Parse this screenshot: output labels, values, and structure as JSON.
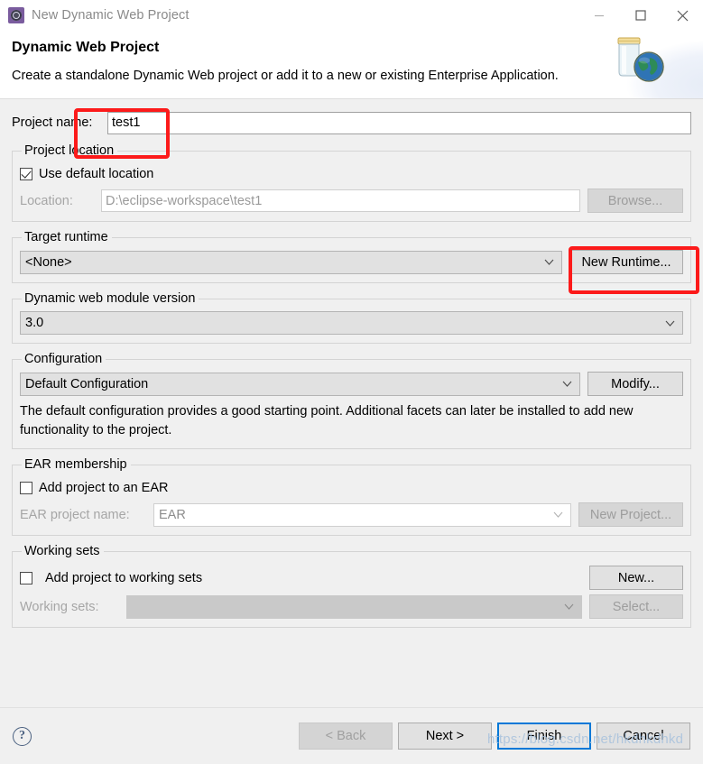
{
  "window": {
    "title": "New Dynamic Web Project",
    "title_icon": "eclipse-project-icon",
    "minimize_icon": "minimize-icon",
    "maximize_icon": "maximize-icon",
    "close_icon": "close-icon"
  },
  "banner": {
    "title": "Dynamic Web Project",
    "description": "Create a standalone Dynamic Web project or add it to a new or existing Enterprise Application.",
    "art_icon": "war-jar-globe-icon"
  },
  "form": {
    "project_name": {
      "label": "Project name:",
      "value": "test1"
    },
    "project_location": {
      "legend": "Project location",
      "use_default_label": "Use default location",
      "use_default_checked": true,
      "location_label": "Location:",
      "location_value": "D:\\eclipse-workspace\\test1",
      "browse_label": "Browse...",
      "browse_enabled": false
    },
    "target_runtime": {
      "legend": "Target runtime",
      "value": "<None>",
      "new_runtime_label": "New Runtime...",
      "new_runtime_enabled": true
    },
    "module_version": {
      "legend": "Dynamic web module version",
      "value": "3.0"
    },
    "configuration": {
      "legend": "Configuration",
      "value": "Default Configuration",
      "modify_label": "Modify...",
      "description": "The default configuration provides a good starting point. Additional facets can later be installed to add new functionality to the project."
    },
    "ear_membership": {
      "legend": "EAR membership",
      "add_to_ear_label": "Add project to an EAR",
      "add_to_ear_checked": false,
      "ear_project_label": "EAR project name:",
      "ear_project_value": "EAR",
      "new_project_label": "New Project...",
      "new_project_enabled": false
    },
    "working_sets": {
      "legend": "Working sets",
      "add_to_working_sets_label": "Add project to working sets",
      "add_to_working_sets_checked": false,
      "working_sets_label": "Working sets:",
      "working_sets_value": "",
      "new_label": "New...",
      "new_enabled": true,
      "select_label": "Select...",
      "select_enabled": false
    }
  },
  "footer": {
    "help_glyph": "?",
    "back_label": "< Back",
    "back_enabled": false,
    "next_label": "Next >",
    "finish_label": "Finish",
    "cancel_label": "Cancel"
  },
  "annotations": [
    {
      "name": "project-name-highlight"
    },
    {
      "name": "new-runtime-highlight"
    }
  ],
  "watermark": {
    "text": "https://blog.csdn.net/hkdhkdhkd"
  },
  "colors": {
    "annotation": "#fc1a1a",
    "default_button_border": "#0078d7",
    "dialog_bg": "#f0f0f0"
  }
}
